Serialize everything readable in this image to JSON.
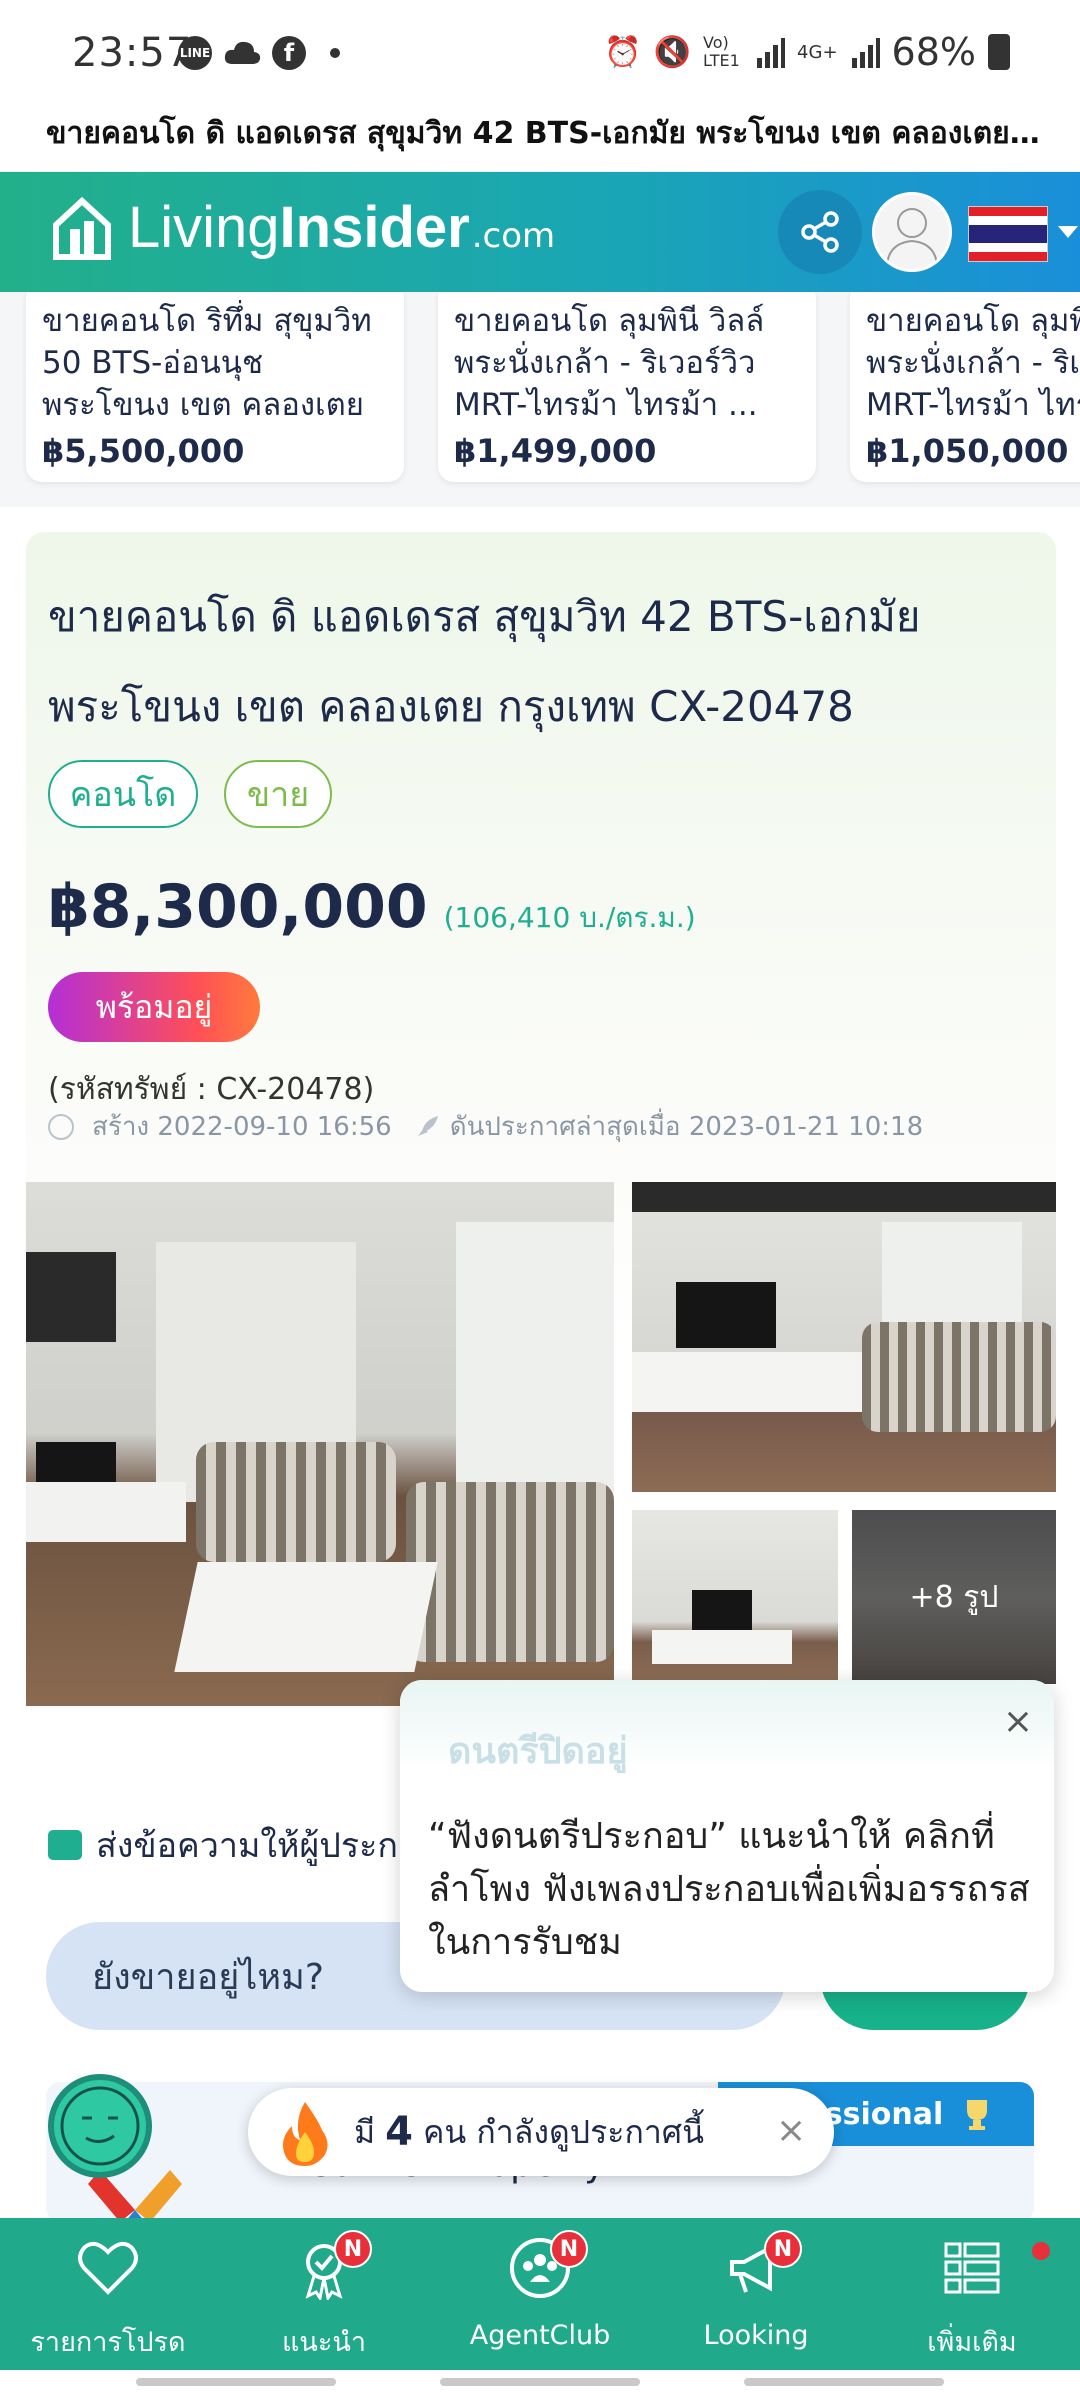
{
  "status_bar": {
    "time": "23:57",
    "battery": "68%",
    "network_label": "Vo) LTE1",
    "network_label_2": "4G+"
  },
  "title_strip": {
    "text": "ขายคอนโด ดิ แอดเดรส สุขุมวิท 42 BTS-เอกมัย พระโขนง เขต คลองเตย กรุงเทพ..."
  },
  "header": {
    "brand_light": "Living",
    "brand_bold": "Insider",
    "brand_suffix": ".com"
  },
  "related_listings": [
    {
      "title": "ขายคอนโด  ริทึ่ม สุขุมวิท 50 BTS-อ่อนนุช พระโขนง เขต คลองเตย กรุงเทพ C...",
      "price": "฿5,500,000"
    },
    {
      "title": "ขายคอนโด  ลุมพินี วิลล์ พระนั่งเกล้า - ริเวอร์วิว MRT-ไทรม้า ไทรม้า ...",
      "price": "฿1,499,000"
    },
    {
      "title": "ขายคอนโด  ลุมพินี วิลล์ พระนั่งเกล้า - ริเวอร์วิว MRT-ไทรม้า ไทรม้า",
      "price": "฿1,050,000"
    }
  ],
  "listing": {
    "title": "ขายคอนโด ดิ แอดเดรส สุขุมวิท 42 BTS-เอกมัย พระโขนง เขต คลองเตย กรุงเทพ CX-20478",
    "tags": [
      "คอนโด",
      "ขาย"
    ],
    "price": "฿8,300,000",
    "price_per_sqm": "(106,410 บ./ตร.ม.)",
    "status_badge": "พร้อมอยู่",
    "property_code": "(รหัสทรัพย์ : CX-20478)",
    "created": "สร้าง 2022-09-10 16:56",
    "last_boosted": "ดันประกาศล่าสุดเมื่อ 2023-01-21 10:18",
    "more_photos": "+8 รูป"
  },
  "message": {
    "label": "ส่งข้อความให้ผู้ประกาศ",
    "input_value": "ยังขายอยู่ไหม?"
  },
  "tooltip": {
    "title": "ดนตรีปิดอยู่",
    "body": "“ฟังดนตรีประกอบ” แนะนำให้ คลิกที่ ลำโพง ฟังเพลงประกอบเพื่อเพิ่มอรรถรส ในการรับชม",
    "close": "×"
  },
  "agent": {
    "badge": "Professional",
    "name": "Connex Property"
  },
  "viewers": {
    "prefix": "มี",
    "count": "4",
    "suffix": "คน กำลังดูประกาศนี้",
    "close": "×"
  },
  "bottom_nav": [
    {
      "label": "รายการโปรด",
      "icon": "heart-icon",
      "badge": ""
    },
    {
      "label": "แนะนำ",
      "icon": "award-icon",
      "badge": "N"
    },
    {
      "label": "AgentClub",
      "icon": "people-icon",
      "badge": "N"
    },
    {
      "label": "Looking",
      "icon": "megaphone-icon",
      "badge": "N"
    },
    {
      "label": "เพิ่มเติม",
      "icon": "grid-menu-icon",
      "badge": ""
    }
  ],
  "colors": {
    "brand_green": "#20a98a",
    "accent_teal": "#1fae8f",
    "badge_red": "#e8303a",
    "header_blue": "#1a8fd9"
  }
}
